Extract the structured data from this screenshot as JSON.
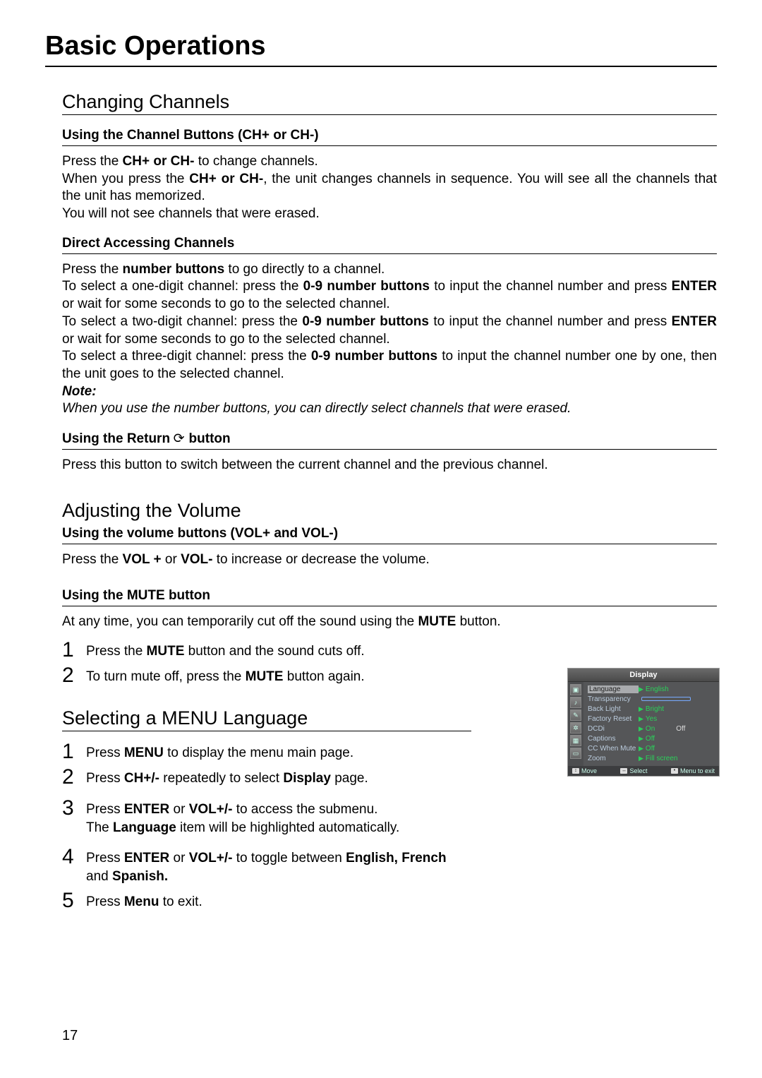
{
  "page_number": "17",
  "title": "Basic Operations",
  "changing_channels": {
    "heading": "Changing Channels",
    "sub1": {
      "title": "Using the Channel Buttons (CH+ or CH-)",
      "p1a": "Press the ",
      "p1b": "CH+ or CH-",
      "p1c": "  to change channels.",
      "p2a": "When you press the ",
      "p2b": "CH+ or CH-",
      "p2c": ", the unit changes channels in sequence. You will see all the channels that the unit has memorized.",
      "p3": "You will not see channels that were erased."
    },
    "sub2": {
      "title": "Direct Accessing Channels",
      "p1a": "Press the ",
      "p1b": "number buttons",
      "p1c": " to go directly to a channel.",
      "p2a": "To select a one-digit channel: press the ",
      "p2b": "0-9 number buttons",
      "p2c": " to input the channel number and press ",
      "p2d": "ENTER",
      "p2e": " or wait for some seconds to go to the selected channel.",
      "p3a": "To select a two-digit channel: press the ",
      "p3b": "0-9 number buttons",
      "p3c": " to input the channel number and press ",
      "p3d": "ENTER",
      "p3e": " or wait for some seconds to go to the selected channel.",
      "p4a": "To select a three-digit channel:  press the ",
      "p4b": "0-9 number buttons",
      "p4c": " to input the channel number one by one, then the unit goes to the selected channel.",
      "note_label": "Note:",
      "note_body": "When you use the number buttons, you can directly select channels  that  were erased."
    },
    "sub3": {
      "title_before": "Using the Return",
      "title_after": " button",
      "p1": "Press this button to switch between the current channel and the  previous channel."
    }
  },
  "volume": {
    "heading": "Adjusting the Volume",
    "sub1": {
      "title": "Using the volume buttons (VOL+ and VOL-)",
      "p1a": "Press the ",
      "p1b": "VOL +",
      "p1c": " or ",
      "p1d": "VOL-",
      "p1e": " to increase or decrease the volume."
    },
    "sub2": {
      "title": "Using the MUTE button",
      "p1a": "At any time, you can temporarily cut off the sound using the ",
      "p1b": "MUTE",
      "p1c": " button.",
      "step1a": "Press the ",
      "step1b": "MUTE",
      "step1c": " button and the sound cuts off.",
      "step2a": "To turn mute off, press the  ",
      "step2b": "MUTE",
      "step2c": " button again."
    }
  },
  "menu_lang": {
    "heading": "Selecting a MENU Language",
    "step1a": "Press  ",
    "step1b": "MENU",
    "step1c": " to display the menu main page.",
    "step2a": "Press ",
    "step2b": "CH+/-",
    "step2c": " repeatedly to select ",
    "step2d": "Display",
    "step2e": " page.",
    "step3a": "Press ",
    "step3b": "ENTER",
    "step3c": " or ",
    "step3d": "VOL+/-",
    "step3e": " to access the submenu.",
    "step3f": "The ",
    "step3g": "Language",
    "step3h": " item will be highlighted automatically.",
    "step4a": "Press ",
    "step4b": "ENTER",
    "step4c": " or ",
    "step4d": "VOL+/-",
    "step4e": " to toggle between ",
    "step4f": "English, French",
    "step4g": " and ",
    "step4h": "Spanish.",
    "step5a": "Press ",
    "step5b": "Menu",
    "step5c": " to exit."
  },
  "osd": {
    "title": "Display",
    "rows": [
      {
        "k": "Language",
        "v": "English",
        "selected": true
      },
      {
        "k": "Transparency",
        "slider": true
      },
      {
        "k": "Back Light",
        "v": "Bright"
      },
      {
        "k": "Factory Reset",
        "v": "Yes"
      },
      {
        "k": "DCDi",
        "v": "On",
        "extra": "Off"
      },
      {
        "k": "Captions",
        "v": "Off"
      },
      {
        "k": "CC When Mute",
        "v": "Off"
      },
      {
        "k": "Zoom",
        "v": "Fill screen"
      }
    ],
    "footer": {
      "move": "Move",
      "select": "Select",
      "menu_exit": "Menu to exit"
    }
  }
}
